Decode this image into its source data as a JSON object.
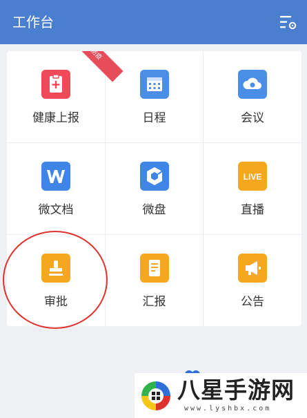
{
  "header": {
    "title": "工作台",
    "settings_icon": "filter-settings-icon"
  },
  "apps": [
    {
      "label": "健康上报",
      "icon": "clipboard-plus-icon",
      "color": "#f04a5a",
      "ribbon": "防疫"
    },
    {
      "label": "日程",
      "icon": "calendar-icon",
      "color": "#4a8ee8"
    },
    {
      "label": "会议",
      "icon": "cloud-icon",
      "color": "#4a8ee8"
    },
    {
      "label": "微文档",
      "icon": "w-doc-icon",
      "color": "#3f85e6"
    },
    {
      "label": "微盘",
      "icon": "cube-drive-icon",
      "color": "#3f85e6"
    },
    {
      "label": "直播",
      "icon": "live-icon",
      "color": "#f5a81f",
      "icon_text": "LIVE"
    },
    {
      "label": "审批",
      "icon": "stamp-icon",
      "color": "#f5a81f"
    },
    {
      "label": "汇报",
      "icon": "report-doc-icon",
      "color": "#f5a81f"
    },
    {
      "label": "公告",
      "icon": "megaphone-icon",
      "color": "#f5a81f"
    }
  ],
  "watermark": {
    "text": "八星手游网",
    "url": "www.lyshbx.com"
  },
  "colors": {
    "header_bg": "#4a7fd0",
    "highlight_circle": "#e0322c"
  }
}
